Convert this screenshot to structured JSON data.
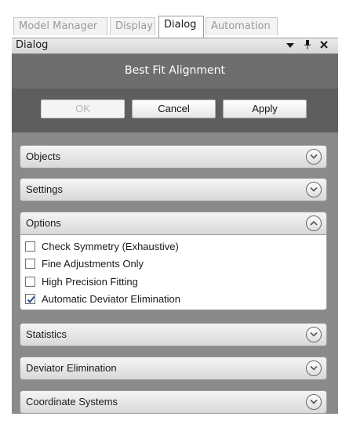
{
  "tabs": [
    {
      "label": "Model Manager",
      "active": false
    },
    {
      "label": "Display",
      "active": false
    },
    {
      "label": "Dialog",
      "active": true
    },
    {
      "label": "Automation",
      "active": false
    }
  ],
  "titlebar": {
    "title": "Dialog",
    "icons": [
      "dropdown-arrow-icon",
      "pin-icon",
      "close-icon"
    ]
  },
  "header": {
    "title": "Best Fit Alignment"
  },
  "buttons": {
    "ok": "OK",
    "cancel": "Cancel",
    "apply": "Apply"
  },
  "sections": {
    "objects": "Objects",
    "settings": "Settings",
    "options": "Options",
    "statistics": "Statistics",
    "deviator": "Deviator Elimination",
    "coords": "Coordinate Systems"
  },
  "options": [
    {
      "label": "Check Symmetry (Exhaustive)",
      "checked": false
    },
    {
      "label": "Fine Adjustments Only",
      "checked": false
    },
    {
      "label": "High Precision Fitting",
      "checked": false
    },
    {
      "label": "Automatic Deviator Elimination",
      "checked": true
    }
  ]
}
